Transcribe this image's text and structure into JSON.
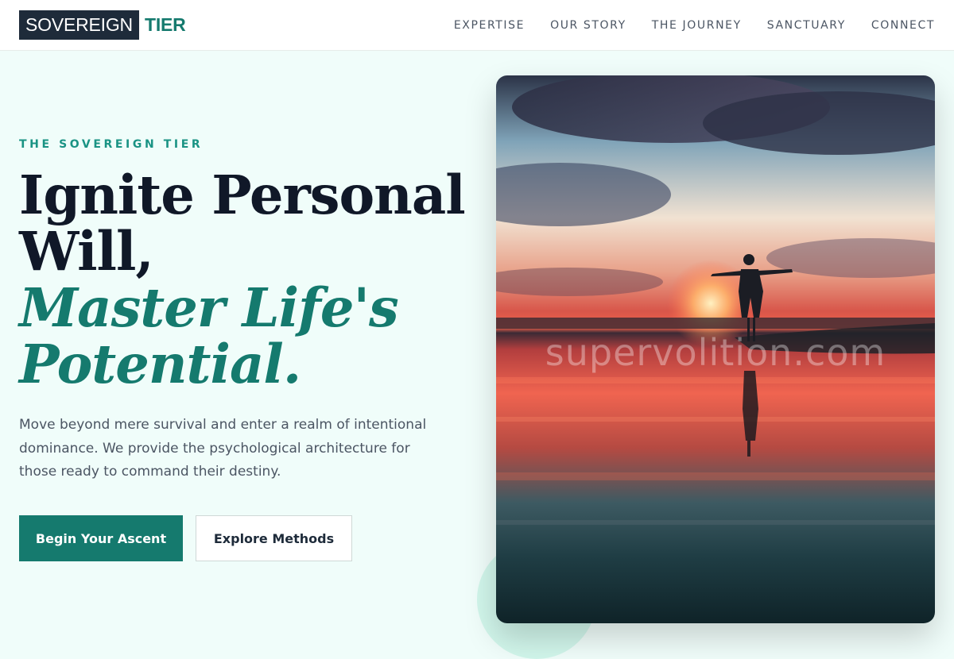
{
  "header": {
    "logo_primary": "SOVEREIGN",
    "logo_accent": "TIER",
    "nav": [
      "EXPERTISE",
      "OUR STORY",
      "THE JOURNEY",
      "SANCTUARY",
      "CONNECT"
    ]
  },
  "hero": {
    "eyebrow": "THE SOVEREIGN TIER",
    "headline_line1": "Ignite Personal",
    "headline_line2": "Will,",
    "headline_accent_line1": "Master Life's",
    "headline_accent_line2": "Potential.",
    "lead": "Move beyond mere survival and enter a realm of intentional dominance. We provide the psychological architecture for those ready to command their destiny.",
    "primary_cta": "Begin Your Ascent",
    "secondary_cta": "Explore Methods",
    "image_watermark": "supervolition.com"
  },
  "colors": {
    "accent": "#157a6e",
    "dark": "#101828",
    "background": "#f0fdfa"
  }
}
